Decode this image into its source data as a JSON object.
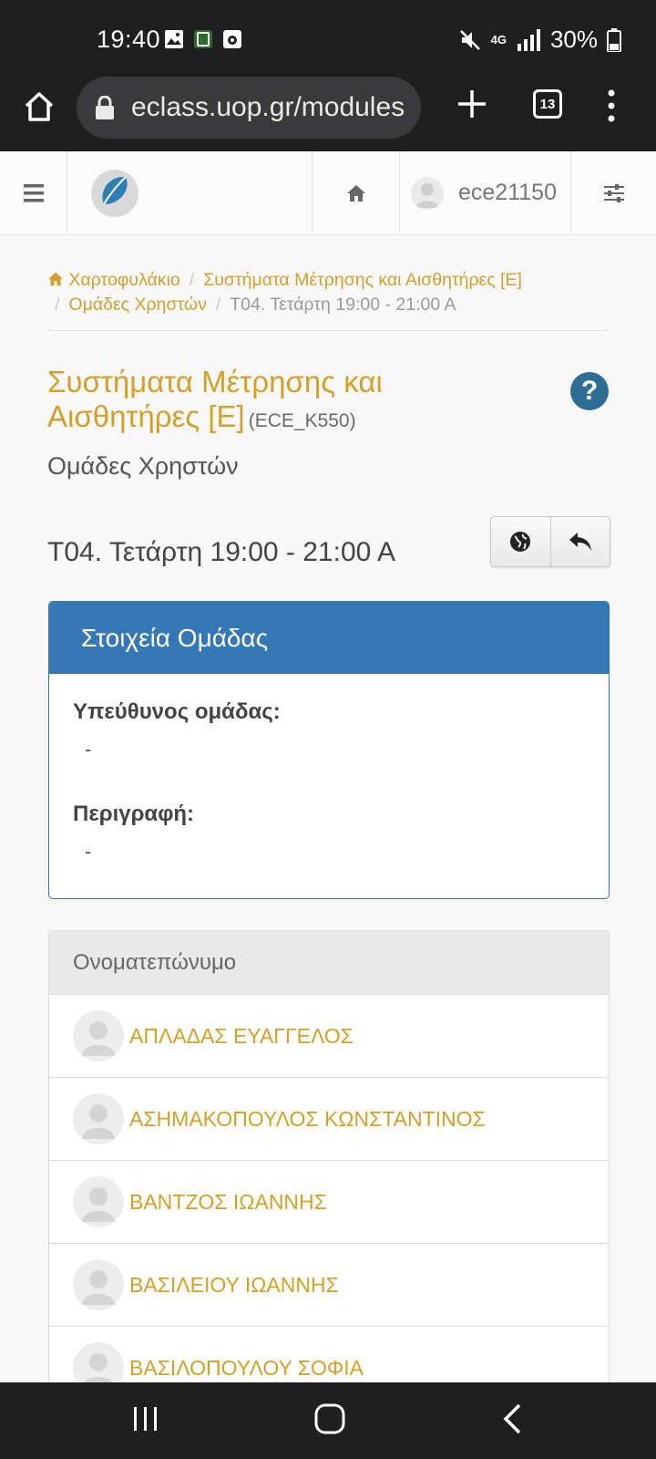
{
  "status_bar": {
    "time": "19:40",
    "network": "4G",
    "battery": "30%"
  },
  "browser": {
    "url": "eclass.uop.gr/modules",
    "tab_count": "13"
  },
  "navbar": {
    "username": "ece21150"
  },
  "breadcrumb": {
    "items": [
      "Χαρτοφυλάκιο",
      "Συστήματα Μέτρησης και Αισθητήρες [Ε]",
      "Ομάδες Χρηστών",
      "Τ04. Τετάρτη 19:00 - 21:00 Α"
    ]
  },
  "course": {
    "title_line1": "Συστήματα Μέτρησης και",
    "title_line2": "Αισθητήρες [Ε]",
    "code": "(ECE_K550)",
    "module": "Ομάδες Χρηστών",
    "help": "?"
  },
  "group": {
    "title": "Τ04. Τετάρτη 19:00 - 21:00 Α"
  },
  "info_panel": {
    "heading": "Στοιχεία Ομάδας",
    "leader_label": "Υπεύθυνος ομάδας:",
    "leader_value": "-",
    "description_label": "Περιγραφή:",
    "description_value": "-"
  },
  "members": {
    "header": "Ονοματεπώνυμο",
    "rows": [
      "ΑΠΛΑΔΑΣ ΕΥΑΓΓΕΛΟΣ",
      "ΑΣΗΜΑΚΟΠΟΥΛΟΣ ΚΩΝΣΤΑΝΤΙΝΟΣ",
      "ΒΑΝΤΖΟΣ ΙΩΑΝΝΗΣ",
      "ΒΑΣΙΛΕΙΟΥ ΙΩΑΝΝΗΣ",
      "ΒΑΣΙΛΟΠΟΥΛΟΥ ΣΟΦΙΑ"
    ]
  },
  "colors": {
    "accent": "#d4a02a",
    "panel_blue": "#3678b6",
    "help_blue": "#2f6e94"
  }
}
